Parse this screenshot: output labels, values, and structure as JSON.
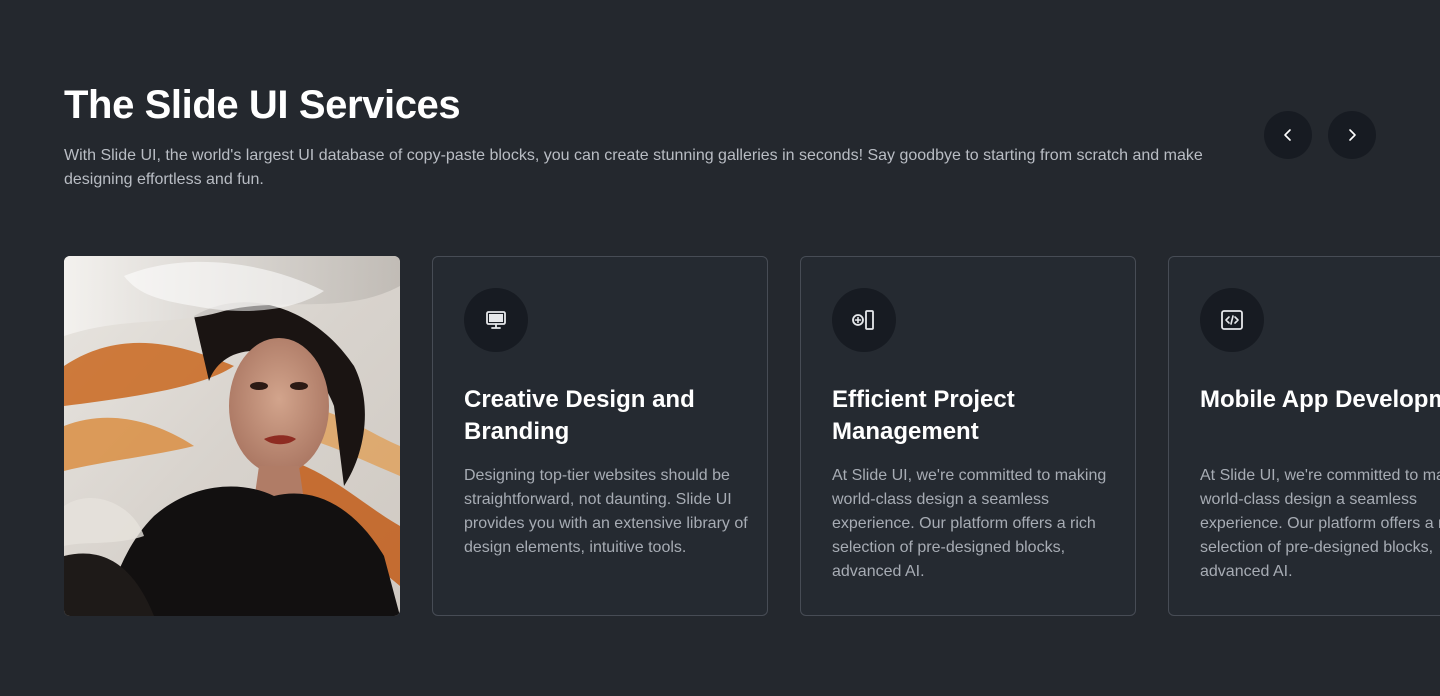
{
  "header": {
    "title": "The Slide UI Services",
    "subtitle": "With Slide UI, the world's largest UI database of copy-paste blocks, you can create stunning galleries in seconds! Say goodbye to starting from scratch and make designing effortless and fun."
  },
  "navigation": {
    "prev_icon": "chevron-left-icon",
    "next_icon": "chevron-right-icon"
  },
  "cards": [
    {
      "icon": "monitor-icon",
      "title": "Creative Design and Branding",
      "text": "Designing top-tier websites should be straightforward, not daunting. Slide UI provides you with an extensive library of design elements, intuitive tools."
    },
    {
      "icon": "add-column-icon",
      "title": "Efficient Project Management",
      "text": "At Slide UI, we're committed to making world-class design a seamless experience. Our platform offers a rich selection of pre-designed blocks, advanced AI."
    },
    {
      "icon": "code-file-icon",
      "title": "Mobile App Development",
      "text": "At Slide UI, we're committed to making world-class design a seamless experience. Our platform offers a rich selection of pre-designed blocks, advanced AI."
    }
  ],
  "colors": {
    "background": "#24282e",
    "card_background": "#252a31",
    "card_border": "#474c55",
    "icon_circle": "#171b22",
    "heading": "#ffffff",
    "body_text": "#a7acb4"
  }
}
